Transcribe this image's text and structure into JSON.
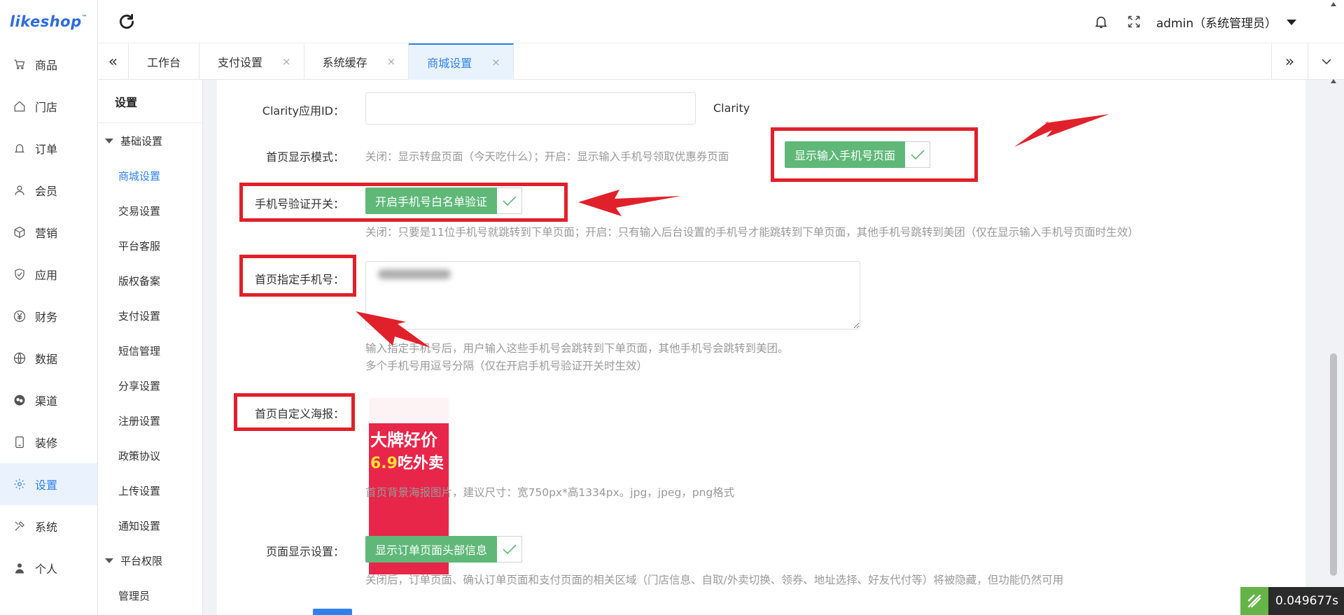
{
  "app": {
    "logo": "likeshop",
    "logo_tm": "™"
  },
  "header": {
    "user": "admin（系统管理员）"
  },
  "sidebar": {
    "items": [
      {
        "label": "商品",
        "icon": "cart-icon"
      },
      {
        "label": "门店",
        "icon": "home-icon"
      },
      {
        "label": "订单",
        "icon": "bell-icon"
      },
      {
        "label": "会员",
        "icon": "user-icon"
      },
      {
        "label": "营销",
        "icon": "cube-icon"
      },
      {
        "label": "应用",
        "icon": "shield-icon"
      },
      {
        "label": "财务",
        "icon": "yen-icon"
      },
      {
        "label": "数据",
        "icon": "globe-icon"
      },
      {
        "label": "渠道",
        "icon": "channel-icon"
      },
      {
        "label": "装修",
        "icon": "tablet-icon"
      },
      {
        "label": "设置",
        "icon": "gear-icon"
      },
      {
        "label": "系统",
        "icon": "tools-icon"
      },
      {
        "label": "个人",
        "icon": "person-icon"
      }
    ]
  },
  "tabs": {
    "items": [
      {
        "label": "工作台",
        "closable": false
      },
      {
        "label": "支付设置",
        "closable": true
      },
      {
        "label": "系统缓存",
        "closable": true
      },
      {
        "label": "商城设置",
        "closable": true
      }
    ],
    "close": "×"
  },
  "subnav": {
    "title": "设置",
    "group1": "基础设置",
    "items": [
      "商城设置",
      "交易设置",
      "平台客服",
      "版权备案",
      "支付设置",
      "短信管理",
      "分享设置",
      "注册设置",
      "政策协议",
      "上传设置",
      "通知设置"
    ],
    "group2": "平台权限",
    "items2": [
      "管理员"
    ]
  },
  "form": {
    "clarity_label": "Clarity应用ID：",
    "clarity_value": "",
    "clarity_suffix": "Clarity",
    "home_mode_label": "首页显示模式：",
    "home_mode_hint": "关闭：显示转盘页面（今天吃什么）；开启：显示输入手机号领取优惠券页面",
    "home_mode_switch": "显示输入手机号页面",
    "phone_verify_label": "手机号验证开关：",
    "phone_verify_switch": "开启手机号白名单验证",
    "phone_verify_hint": "关闭：只要是11位手机号就跳转到下单页面；开启：只有输入后台设置的手机号才能跳转到下单页面，其他手机号跳转到美团（仅在显示输入手机号页面时生效）",
    "phones_label": "首页指定手机号：",
    "phones_hint1": "输入指定手机号后，用户输入这些手机号会跳转到下单页面，其他手机号会跳转到美团。",
    "phones_hint2": "多个手机号用逗号分隔（仅在开启手机号验证开关时生效）",
    "poster_label": "首页自定义海报：",
    "poster_text1": "大牌好价",
    "poster_price": "6.9",
    "poster_text2": "吃外卖",
    "poster_hint": "首页背景海报图片，建议尺寸：宽750px*高1334px。jpg，jpeg，png格式",
    "page_display_label": "页面显示设置：",
    "page_display_switch": "显示订单页面头部信息",
    "page_display_hint": "关闭后，订单页面、确认订单页面和支付页面的相关区域（门店信息、自取/外卖切换、领券、地址选择、好友代付等）将被隐藏，但功能仍然可用"
  },
  "timer": "0.049677s",
  "colors": {
    "accent": "#2f80ed",
    "switch_on": "#5fb878",
    "annotation": "#e0212b"
  }
}
